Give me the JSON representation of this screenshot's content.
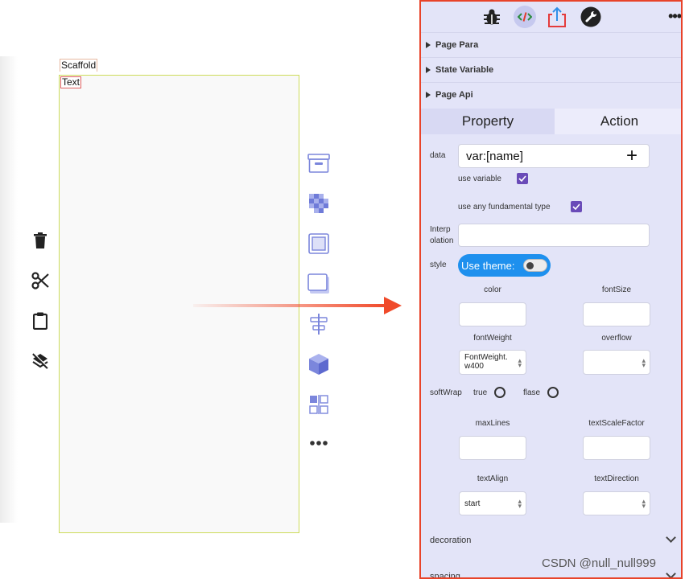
{
  "canvas": {
    "scaffold_label": "Scaffold",
    "text_label": "Text"
  },
  "left_toolbar": [
    {
      "name": "delete-icon"
    },
    {
      "name": "cut-icon"
    },
    {
      "name": "clipboard-icon"
    },
    {
      "name": "layers-off-icon"
    }
  ],
  "palette": [
    {
      "name": "container-icon"
    },
    {
      "name": "checker-icon"
    },
    {
      "name": "frame-icon"
    },
    {
      "name": "card-icon"
    },
    {
      "name": "align-center-icon"
    },
    {
      "name": "cube-icon"
    },
    {
      "name": "grid-icon"
    },
    {
      "name": "more-icon"
    }
  ],
  "panel": {
    "top_icons": [
      "bug-icon",
      "code-icon",
      "share-icon",
      "wrench-icon"
    ],
    "more": "•••",
    "sections": [
      "Page Para",
      "State Variable",
      "Page Api"
    ],
    "tabs": {
      "property": "Property",
      "action": "Action"
    },
    "data_label": "data",
    "data_value": "var:[name]",
    "plus": "+",
    "use_variable": "use variable",
    "use_any_type": "use any fundamental type",
    "interp_label_1": "Interp",
    "interp_label_2": "olation",
    "style_label": "style",
    "use_theme": "Use theme:",
    "color_label": "color",
    "fontsize_label": "fontSize",
    "fontweight_label": "fontWeight",
    "overflow_label": "overflow",
    "fontweight_value_1": "FontWeight.",
    "fontweight_value_2": "w400",
    "softwrap_label": "softWrap",
    "true_label": "true",
    "false_label": "flase",
    "maxlines_label": "maxLines",
    "textscale_label": "textScaleFactor",
    "textalign_label": "textAlign",
    "textdirection_label": "textDirection",
    "textalign_value": "start",
    "decoration_label": "decoration",
    "spacing_label": "spacing"
  },
  "watermark": "CSDN @null_null999",
  "colors": {
    "panel_bg": "#e3e4f8",
    "panel_border": "#e8432a",
    "accent": "#6a4bb8",
    "toggle": "#1e90ee",
    "arrow": "#f04a2a"
  }
}
